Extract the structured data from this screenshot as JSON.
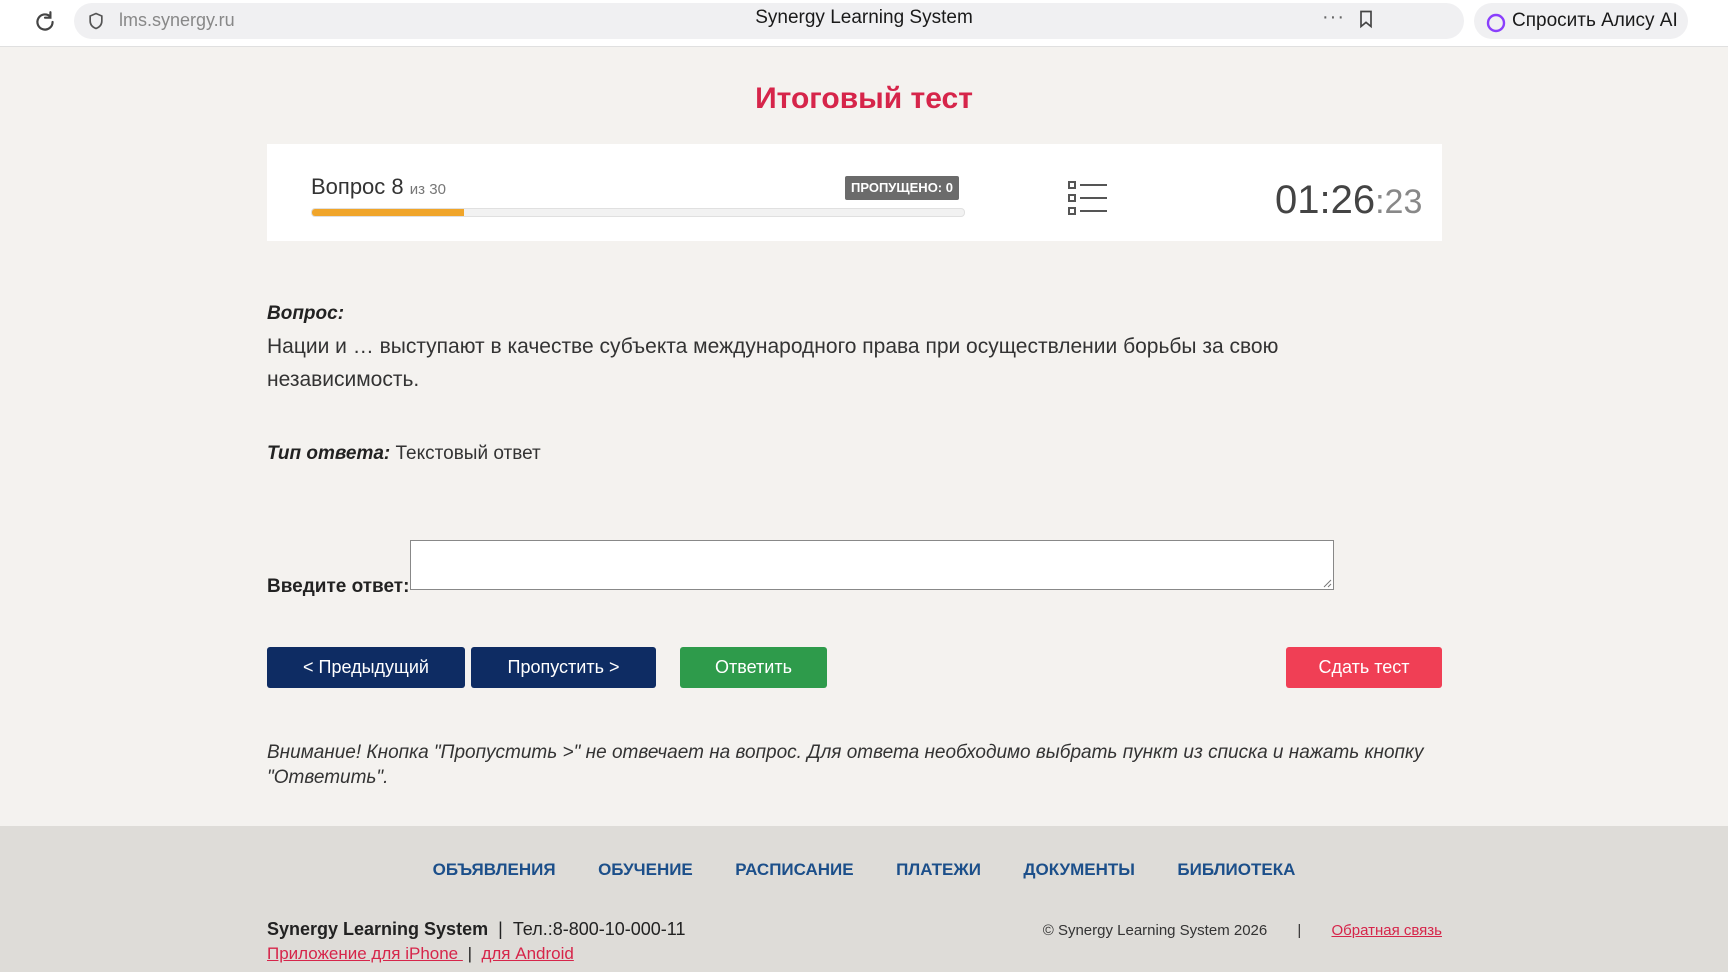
{
  "browser": {
    "url": "lms.synergy.ru",
    "title": "Synergy Learning System",
    "alice_label": "Спросить Алису AI",
    "menu_dots": "···"
  },
  "test": {
    "title": "Итоговый тест",
    "question_word": "Вопрос",
    "question_number": "8",
    "question_of": "из 30",
    "progress_fraction": 0.233,
    "skipped_label": "ПРОПУЩЕНО: 0",
    "timer_main": "01:26",
    "timer_seconds": ":23",
    "accent_color": "#d6254a",
    "progress_color": "#f0a52a"
  },
  "question": {
    "heading": "Вопрос:",
    "text": "Нации и … выступают в качестве субъекта международного права при осуществлении борьбы за свою независимость.",
    "answer_type_label": "Тип ответа:",
    "answer_type_value": " Текстовый ответ",
    "answer_label": "Введите ответ:",
    "answer_value": "",
    "answer_placeholder": ""
  },
  "buttons": {
    "prev": "< Предыдущий",
    "skip": "Пропустить >",
    "answer": "Ответить",
    "submit": "Сдать тест"
  },
  "notice": "Внимание! Кнопка \"Пропустить >\" не отвечает на вопрос. Для ответа необходимо выбрать пункт из списка и нажать кнопку \"Ответить\".",
  "footer": {
    "nav": [
      "ОБЪЯВЛЕНИЯ",
      "ОБУЧЕНИЕ",
      "РАСПИСАНИЕ",
      "ПЛАТЕЖИ",
      "ДОКУМЕНТЫ",
      "БИБЛИОТЕКА"
    ],
    "brand": "Synergy Learning System",
    "phone": "Тел.:8-800-10-000-11",
    "app_iphone": "Приложение для iPhone ",
    "app_android": "для Android",
    "copyright": "© Synergy Learning System 2026",
    "feedback": "Обратная связь"
  }
}
